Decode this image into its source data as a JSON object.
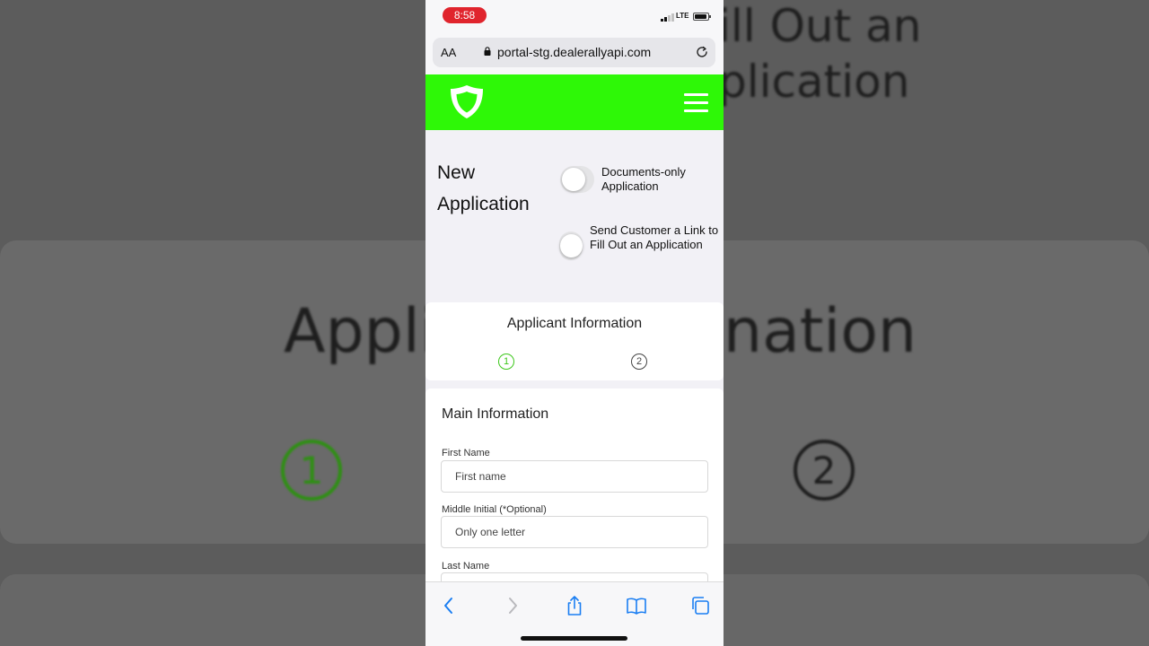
{
  "backdrop": {
    "line1": "ill Out an",
    "line2": "plication",
    "big_left": "Appli",
    "big_right": "nation",
    "step1": "1",
    "step2": "2"
  },
  "status_bar": {
    "time": "8:58",
    "network": "LTE"
  },
  "browser": {
    "text_size_label": "AA",
    "url": "portal-stg.dealerallyapi.com"
  },
  "app_header": {
    "brand_color": "#2ef807"
  },
  "page": {
    "title": "New Application",
    "toggle_documents_label": "Documents-only Application",
    "toggle_send_link_label": "Send Customer a Link to Fill Out an Application"
  },
  "applicant_section": {
    "title": "Applicant Information",
    "steps": [
      "1",
      "2"
    ],
    "active_step": 1,
    "active_color": "#3cc71a"
  },
  "main_info": {
    "heading": "Main Information",
    "first_name_label": "First Name",
    "first_name_placeholder": "First name",
    "middle_initial_label": "Middle Initial (*Optional)",
    "middle_initial_placeholder": "Only one letter",
    "last_name_label": "Last Name"
  }
}
